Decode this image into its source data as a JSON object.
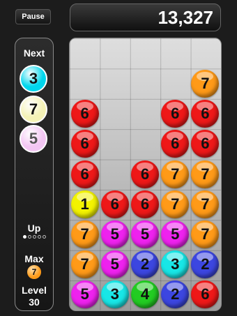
{
  "header": {
    "pause_label": "Pause",
    "score": "13,327"
  },
  "side": {
    "next_label": "Next",
    "next": [
      {
        "value": "3",
        "color": "#00d6ec"
      },
      {
        "value": "7",
        "color": "#f4f2b6"
      },
      {
        "value": "5",
        "color": "#f3c6f3"
      }
    ],
    "up_label": "Up",
    "up_progress": {
      "filled": 1,
      "total": 5
    },
    "max_label": "Max",
    "max_value": "7",
    "level_label": "Level",
    "level_value": "30"
  },
  "colors": {
    "1": "#f3f300",
    "2": "#3c46e0",
    "3": "#18e6e6",
    "4": "#22cc22",
    "5": "#ee22ee",
    "6": "#ee1818",
    "7": "#ff9a18"
  },
  "board": {
    "columns": 5,
    "rows": 9,
    "grid": [
      [
        "",
        "",
        "",
        "",
        ""
      ],
      [
        "",
        "",
        "",
        "",
        "7"
      ],
      [
        "6",
        "",
        "",
        "6",
        "6"
      ],
      [
        "6",
        "",
        "",
        "6",
        "6"
      ],
      [
        "6",
        "",
        "6",
        "7",
        "7"
      ],
      [
        "1",
        "6",
        "6",
        "7",
        "7"
      ],
      [
        "7",
        "5",
        "5",
        "5",
        "7"
      ],
      [
        "7",
        "5",
        "2",
        "3",
        "2"
      ],
      [
        "5",
        "3",
        "4",
        "2",
        "6"
      ]
    ]
  }
}
